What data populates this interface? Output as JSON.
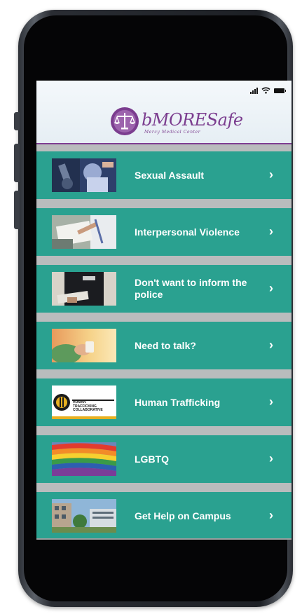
{
  "header": {
    "logo_text": "bMORESafe",
    "logo_subtext": "Mercy Medical Center"
  },
  "status_bar": {
    "signal_icon": "cellular-signal-icon",
    "wifi_icon": "wifi-icon",
    "battery_icon": "battery-icon"
  },
  "menu": {
    "items": [
      {
        "label": "Sexual Assault",
        "image": "microscope-lab-photo"
      },
      {
        "label": "Interpersonal Violence",
        "image": "clipboard-writing-photo"
      },
      {
        "label": "Don't want to inform the police",
        "image": "police-officer-photo"
      },
      {
        "label": "Need to talk?",
        "image": "hand-holding-cup-photo"
      },
      {
        "label": "Human Trafficking",
        "image": "human-trafficking-collaborative-logo",
        "thumb_text": [
          "HUMAN",
          "TRAFFICKING",
          "COLLABORATIVE"
        ]
      },
      {
        "label": "LGBTQ",
        "image": "rainbow-flag-photo"
      },
      {
        "label": "Get Help on Campus",
        "image": "campus-buildings-photo"
      }
    ]
  },
  "colors": {
    "row_background": "#2aa190",
    "brand_purple": "#7b3d8f",
    "separator": "#b9bcbd"
  }
}
